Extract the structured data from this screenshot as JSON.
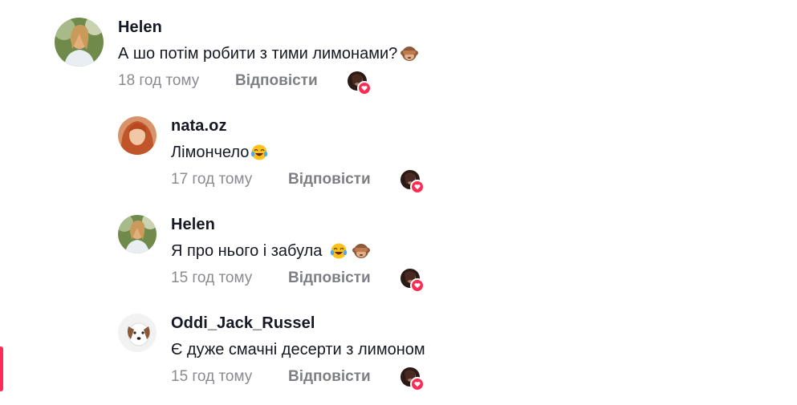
{
  "comments": [
    {
      "username": "Helen",
      "text": "А шо потім робити з тими лимонами?",
      "emojis": [
        "see-no-evil-monkey"
      ],
      "time": "18 год тому",
      "reply_label": "Відповісти",
      "liked_by_creator": true
    },
    {
      "username": "nata.oz",
      "text": "Лімончело",
      "emojis": [
        "tears-of-joy"
      ],
      "time": "17 год тому",
      "reply_label": "Відповісти",
      "liked_by_creator": true
    },
    {
      "username": "Helen",
      "text": "Я про нього і забула",
      "emojis": [
        "tears-of-joy",
        "see-no-evil-monkey"
      ],
      "time": "15 год тому",
      "reply_label": "Відповісти",
      "liked_by_creator": true
    },
    {
      "username": "Oddi_Jack_Russel",
      "text": "Є дуже смачні десерти з лимоном",
      "emojis": [],
      "time": "15 год тому",
      "reply_label": "Відповісти",
      "liked_by_creator": true
    }
  ],
  "colors": {
    "accent": "#fe2c55",
    "muted": "#8a8b91"
  }
}
